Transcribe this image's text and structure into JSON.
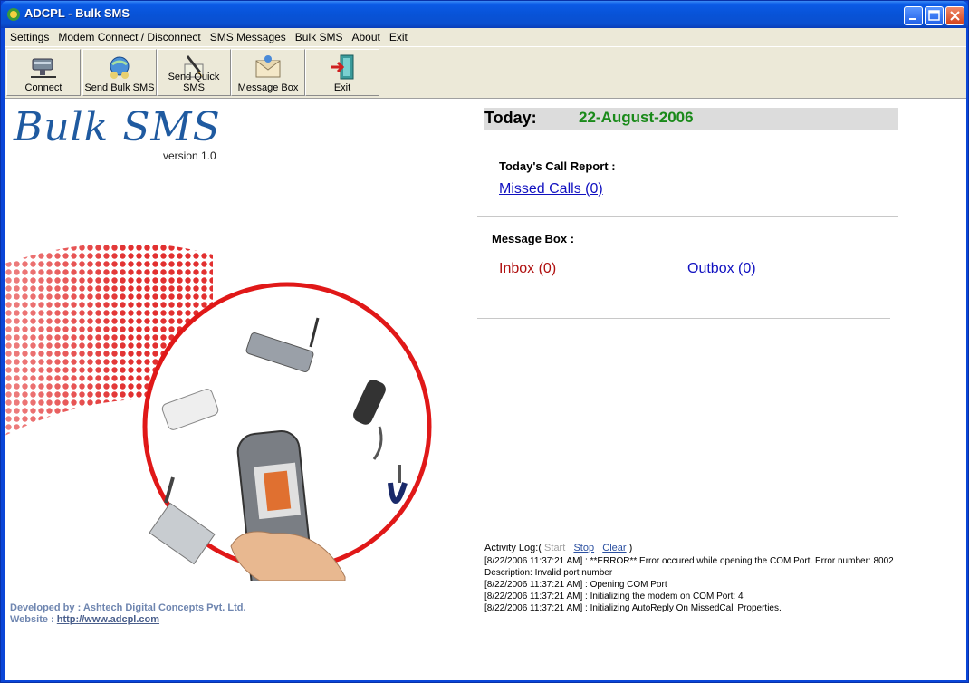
{
  "window": {
    "title": "ADCPL - Bulk SMS"
  },
  "menu": [
    "Settings",
    "Modem Connect / Disconnect",
    "SMS Messages",
    "Bulk SMS",
    "About",
    "Exit"
  ],
  "toolbar": [
    {
      "label": "Connect",
      "icon": "connect-icon"
    },
    {
      "label": "Send Bulk SMS",
      "icon": "send-bulk-sms-icon"
    },
    {
      "label": "Send Quick SMS",
      "icon": "send-quick-sms-icon"
    },
    {
      "label": "Message Box",
      "icon": "message-box-icon"
    },
    {
      "label": "Exit",
      "icon": "exit-icon"
    }
  ],
  "branding": {
    "logo": "Bulk SMS",
    "version": "version 1.0"
  },
  "today": {
    "label": "Today:",
    "date": "22-August-2006"
  },
  "call_report": {
    "label": "Today's Call Report :",
    "missed_calls": "Missed Calls (0)"
  },
  "message_box": {
    "label": "Message Box :",
    "inbox": "Inbox (0)",
    "outbox": "Outbox (0)"
  },
  "activity_log": {
    "label": "Activity Log:",
    "open_paren": "(",
    "start": "Start",
    "stop": "Stop",
    "clear": "Clear",
    "close_paren": ")",
    "lines": [
      "[8/22/2006 11:37:21 AM] : **ERROR** Error occured while opening the COM Port. Error number: 8002 Description: Invalid port number",
      "[8/22/2006 11:37:21 AM] : Opening COM Port",
      "[8/22/2006 11:37:21 AM] : Initializing the modem on COM Port: 4",
      "[8/22/2006 11:37:21 AM] : Initializing AutoReply On MissedCall Properties."
    ]
  },
  "footer": {
    "developed_label": "Developed by : Ashtech Digital Concepts Pvt. Ltd.",
    "website_label": "Website :",
    "website_url": "http://www.adcpl.com"
  },
  "colors": {
    "titlebar": "#0a5ae6",
    "today_date": "#1a8a1a",
    "inbox": "#b01010",
    "outbox": "#1010c0",
    "missed": "#1010c0"
  }
}
